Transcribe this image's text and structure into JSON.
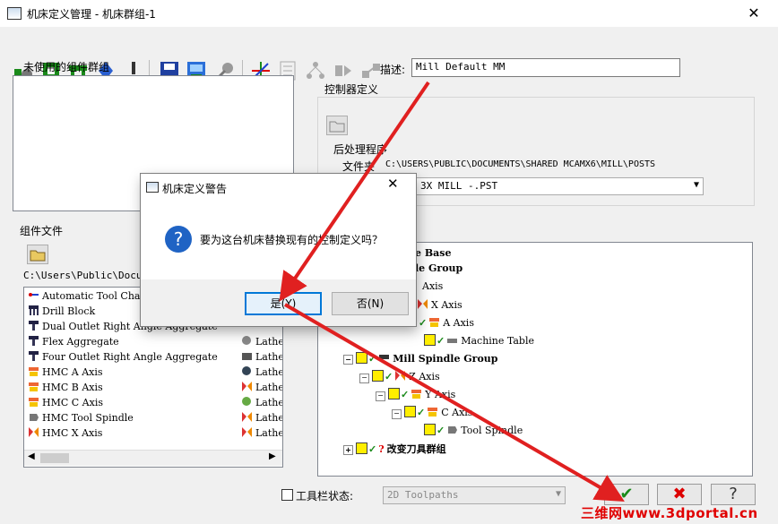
{
  "window": {
    "title": "机床定义管理 - 机床群组-1",
    "close": "✕"
  },
  "toolbar": {
    "icons": [
      "new-machine-icon",
      "open-icon",
      "rotary-icon",
      "axis-icon",
      "warning-icon",
      "save-icon",
      "save-as-icon",
      "tool-icon",
      "axis-triad-icon",
      "list-icon",
      "tree-icon",
      "export-icon",
      "import-icon"
    ]
  },
  "left": {
    "unused_groups_label": "未使用的组件群组",
    "component_files_label": "组件文件",
    "path": "C:\\Users\\Public\\Docum...",
    "items": [
      {
        "name": "Automatic Tool Chan",
        "icon": "atc-icon"
      },
      {
        "name": "Drill Block",
        "icon": "drill-block-icon"
      },
      {
        "name": "Dual Outlet Right Angle Aggregate",
        "icon": "aggregate-icon"
      },
      {
        "name": "Flex Aggregate",
        "icon": "aggregate-icon"
      },
      {
        "name": "Four Outlet Right Angle Aggregate",
        "icon": "aggregate-icon"
      },
      {
        "name": "HMC A Axis",
        "icon": "axis-icon"
      },
      {
        "name": "HMC B Axis",
        "icon": "axis-icon"
      },
      {
        "name": "HMC C Axis",
        "icon": "axis-icon"
      },
      {
        "name": "HMC Tool Spindle",
        "icon": "spindle-icon"
      },
      {
        "name": "HMC X Axis",
        "icon": "axis-icon"
      }
    ],
    "right_col": [
      "Lathe",
      "Lathe",
      "Lathe",
      "Lathe",
      "Lathe",
      "Lathe",
      "Lathe"
    ]
  },
  "right": {
    "description_label": "描述:",
    "description_value": "Mill Default MM",
    "controller_label": "控制器定义",
    "post_label": "后处理程序",
    "folder_label": "文件夹",
    "folder_value": "C:\\USERS\\PUBLIC\\DOCUMENTS\\SHARED MCAMX6\\MILL\\POSTS",
    "post_value": "3X MILL -.PST",
    "tree": [
      "e Base",
      "le Group",
      "Axis",
      "X Axis",
      "A Axis",
      "Machine Table",
      "Mill Spindle Group",
      "Z Axis",
      "Y Axis",
      "C Axis",
      "Tool Spindle",
      "改变刀具群组"
    ]
  },
  "bottom": {
    "toolbar_state_label": "工具栏状态:",
    "toolbar_state_value": "2D Toolpaths",
    "ok": "✔",
    "cancel": "✖",
    "help": "?"
  },
  "dialog": {
    "title": "机床定义警告",
    "message": "要为这台机床替换现有的控制定义吗？",
    "yes": "是(Y)",
    "no": "否(N)",
    "close": "✕"
  },
  "watermark": "三维网www.3dportal.cn",
  "colors": {
    "arrow": "#e02020",
    "accent": "#0078d7",
    "yellow": "#ffee00"
  }
}
